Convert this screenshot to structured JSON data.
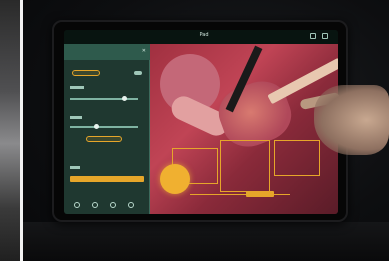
{
  "tablet_app": {
    "title": "Pad",
    "panel": {
      "header": "",
      "close_icon": "close-icon"
    }
  },
  "colors": {
    "accent": "#e6a62a",
    "panel": "#2e5a4c",
    "video_tint": "#c04455"
  }
}
